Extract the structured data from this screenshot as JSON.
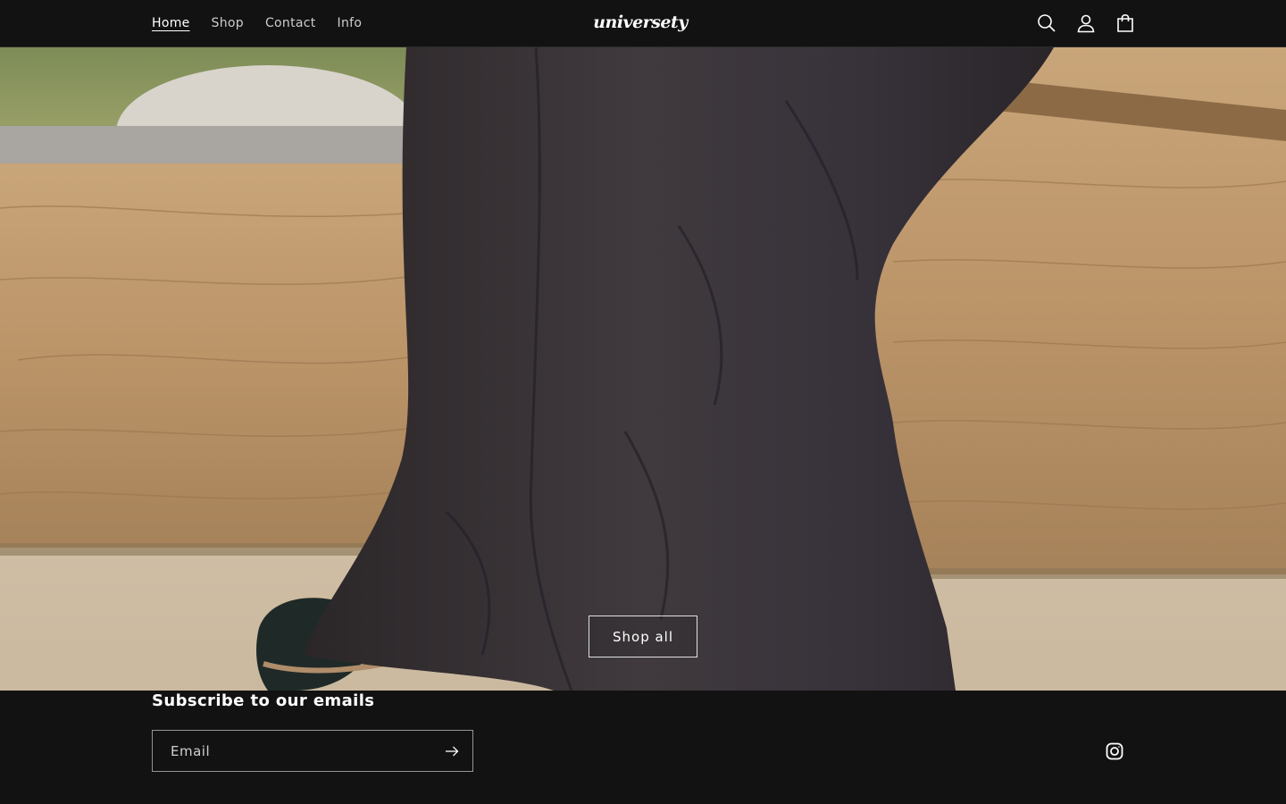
{
  "header": {
    "nav": [
      {
        "label": "Home",
        "active": true
      },
      {
        "label": "Shop",
        "active": false
      },
      {
        "label": "Contact",
        "active": false
      },
      {
        "label": "Info",
        "active": false
      }
    ],
    "logo_text": "universety",
    "icons": [
      "search-icon",
      "account-icon",
      "cart-icon"
    ]
  },
  "hero": {
    "button_label": "Shop all"
  },
  "footer": {
    "subscribe_title": "Subscribe to our emails",
    "email_placeholder": "Email",
    "submit_icon": "arrow-right-icon",
    "social_icon": "instagram-icon"
  },
  "colors": {
    "background": "#121212",
    "text": "#ffffff"
  }
}
